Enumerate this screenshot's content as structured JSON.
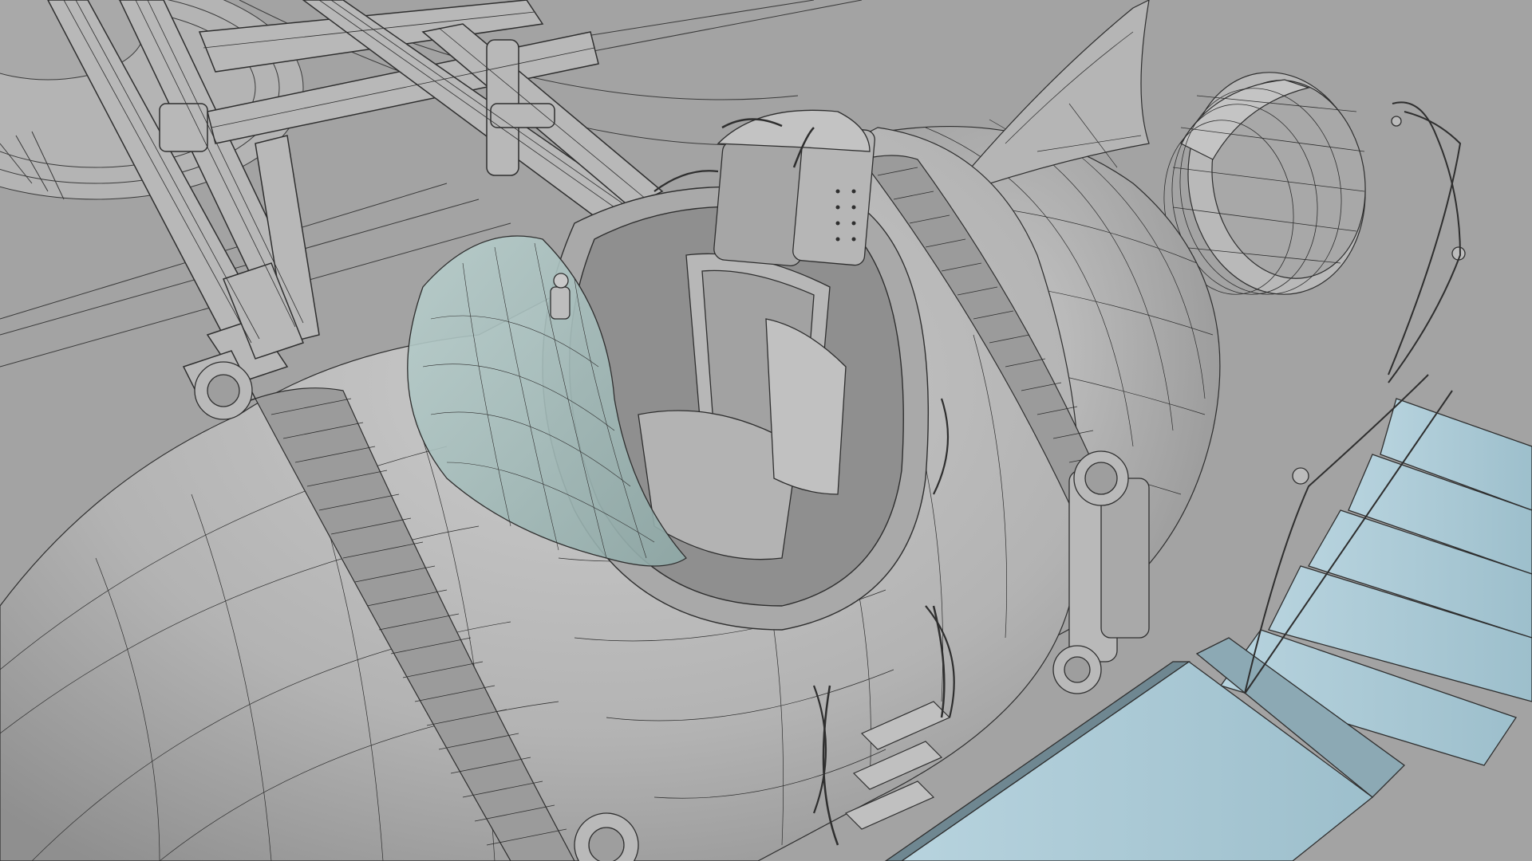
{
  "scene": {
    "subject": "wireframe-render-of-spacecraft-cockpit-pod",
    "colors": {
      "background": "#a3a3a3",
      "surface_light": "#c4c4c4",
      "surface_mid": "#b2b2b2",
      "surface_dark": "#8e8e8e",
      "wire": "#2e2e2e",
      "glass": "#a9c2c0",
      "stairs_glass": "#a7c6d2",
      "stairs_glass_light": "#bcd6e0"
    },
    "icons": {
      "canopy": "glass-canopy-icon",
      "seat": "pilot-seat-icon",
      "engine": "engine-nozzle-icon",
      "fin": "tail-fin-icon",
      "truss": "support-truss-icon",
      "stairs": "glass-stairs-icon",
      "antenna": "antenna-cable-icon",
      "backpack": "life-support-pack-icon"
    }
  }
}
